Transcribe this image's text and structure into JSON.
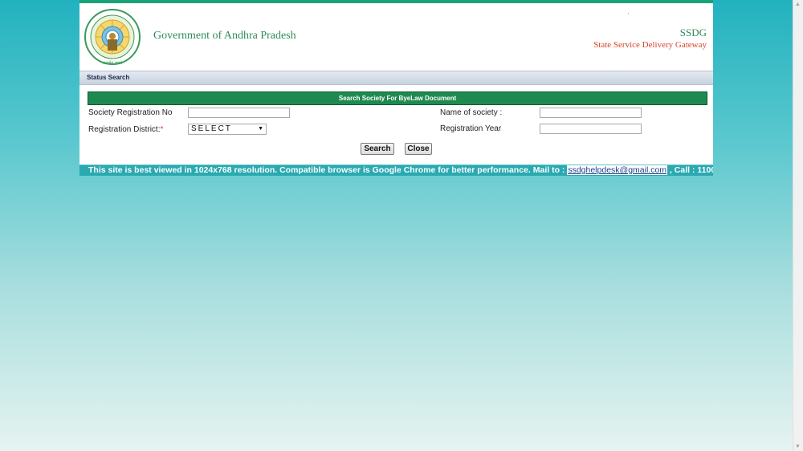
{
  "header": {
    "logo_text": "GOVERNMENT OF ANDHRA PRADESH",
    "gov_title": "Government of Andhra Pradesh",
    "ssdg_abbr": "SSDG",
    "ssdg_full": "State Service Delivery Gateway"
  },
  "breadcrumb": {
    "label": "Status Search"
  },
  "form": {
    "title": "Search Society For ByeLaw Document",
    "society_reg_no_label": "Society Registration No",
    "society_reg_no_value": "",
    "name_of_society_label": "Name of society :",
    "name_of_society_value": "",
    "reg_district_label": "Registration District:",
    "reg_district_required": "*",
    "reg_district_selected": "SELECT",
    "reg_year_label": "Registration Year",
    "reg_year_value": "",
    "search_label": "Search",
    "close_label": "Close"
  },
  "footer": {
    "text": "This site is best viewed in 1024x768 resolution. Compatible browser is Google Chrome for better performance. Mail to : ",
    "email": "ssdghelpdesk@gmail.com",
    "call": " , Call : 1100"
  },
  "colors": {
    "accent_green": "#1f8a4f",
    "title_green": "#2e8b57",
    "ssdg_red": "#d9442a",
    "footer_teal": "#2aa9b1"
  },
  "icons": {
    "logo": "andhra-pradesh-emblem",
    "dropdown": "caret-down-icon"
  }
}
